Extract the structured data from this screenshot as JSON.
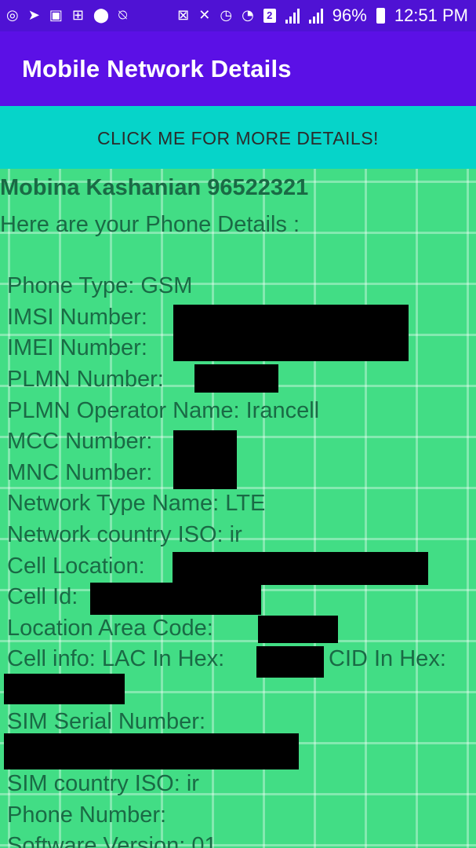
{
  "status_bar": {
    "battery": "96%",
    "time": "12:51 PM",
    "sim_badge": "2",
    "icons_left": [
      "ring-icon",
      "telegram-icon",
      "image-icon",
      "robot-icon",
      "vpn-badge-icon",
      "no-alarm-icon"
    ],
    "icons_right": [
      "lock-icon",
      "mute-icon",
      "alarm-icon",
      "wifi-icon",
      "sim-badge-icon",
      "signal-icon",
      "signal-icon",
      "battery-icon"
    ]
  },
  "app_bar": {
    "title": "Mobile Network Details"
  },
  "button": {
    "label": "CLICK ME FOR MORE DETAILS!"
  },
  "content": {
    "name_line": "Mobina Kashanian 96522321",
    "intro": "Here are your Phone Details :",
    "details": {
      "phone_type": "Phone Type: GSM",
      "imsi": "IMSI Number:",
      "imei": "IMEI Number:",
      "plmn": "PLMN Number:",
      "plmn_operator": "PLMN Operator Name: Irancell",
      "mcc": "MCC Number:",
      "mnc": "MNC Number:",
      "network_type": "Network Type Name: LTE",
      "network_country": "Network country ISO: ir",
      "cell_location": "Cell Location:",
      "cell_id": "Cell Id:",
      "lac": "Location Area Code:",
      "cell_info_lac": "Cell info: LAC In Hex:",
      "cid_hex": "CID In Hex:",
      "sim_serial": "SIM Serial Number:",
      "sim_country": "SIM country ISO: ir",
      "phone_number": "Phone Number:",
      "software_version": "Software Version: 01"
    }
  },
  "colors": {
    "status_bar": "#4f12d4",
    "app_bar": "#5b10e6",
    "button": "#06d4c9",
    "content_bg": "#42dd85",
    "content_text": "#1a6a45"
  }
}
